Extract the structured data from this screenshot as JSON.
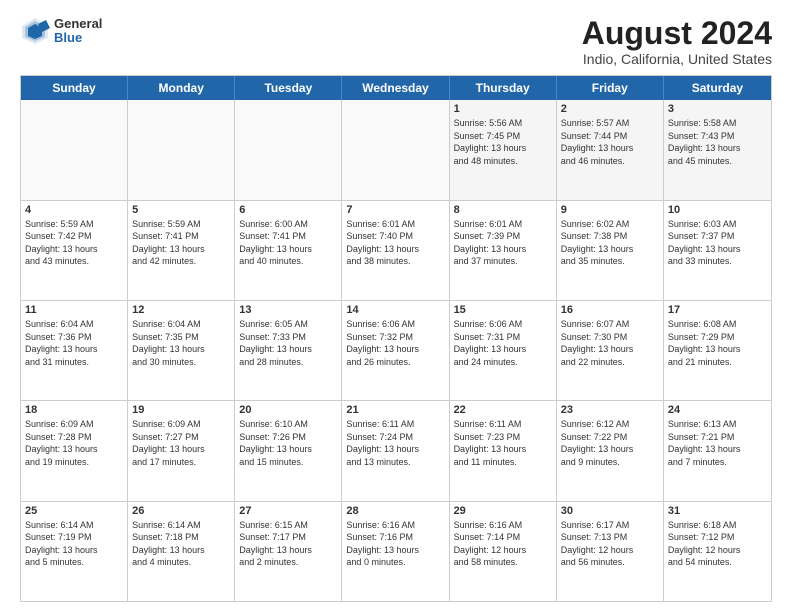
{
  "logo": {
    "general": "General",
    "blue": "Blue"
  },
  "title": "August 2024",
  "subtitle": "Indio, California, United States",
  "days": [
    "Sunday",
    "Monday",
    "Tuesday",
    "Wednesday",
    "Thursday",
    "Friday",
    "Saturday"
  ],
  "weeks": [
    [
      {
        "day": "",
        "text": "",
        "empty": true
      },
      {
        "day": "",
        "text": "",
        "empty": true
      },
      {
        "day": "",
        "text": "",
        "empty": true
      },
      {
        "day": "",
        "text": "",
        "empty": true
      },
      {
        "day": "1",
        "text": "Sunrise: 5:56 AM\nSunset: 7:45 PM\nDaylight: 13 hours\nand 48 minutes."
      },
      {
        "day": "2",
        "text": "Sunrise: 5:57 AM\nSunset: 7:44 PM\nDaylight: 13 hours\nand 46 minutes."
      },
      {
        "day": "3",
        "text": "Sunrise: 5:58 AM\nSunset: 7:43 PM\nDaylight: 13 hours\nand 45 minutes."
      }
    ],
    [
      {
        "day": "4",
        "text": "Sunrise: 5:59 AM\nSunset: 7:42 PM\nDaylight: 13 hours\nand 43 minutes."
      },
      {
        "day": "5",
        "text": "Sunrise: 5:59 AM\nSunset: 7:41 PM\nDaylight: 13 hours\nand 42 minutes."
      },
      {
        "day": "6",
        "text": "Sunrise: 6:00 AM\nSunset: 7:41 PM\nDaylight: 13 hours\nand 40 minutes."
      },
      {
        "day": "7",
        "text": "Sunrise: 6:01 AM\nSunset: 7:40 PM\nDaylight: 13 hours\nand 38 minutes."
      },
      {
        "day": "8",
        "text": "Sunrise: 6:01 AM\nSunset: 7:39 PM\nDaylight: 13 hours\nand 37 minutes."
      },
      {
        "day": "9",
        "text": "Sunrise: 6:02 AM\nSunset: 7:38 PM\nDaylight: 13 hours\nand 35 minutes."
      },
      {
        "day": "10",
        "text": "Sunrise: 6:03 AM\nSunset: 7:37 PM\nDaylight: 13 hours\nand 33 minutes."
      }
    ],
    [
      {
        "day": "11",
        "text": "Sunrise: 6:04 AM\nSunset: 7:36 PM\nDaylight: 13 hours\nand 31 minutes."
      },
      {
        "day": "12",
        "text": "Sunrise: 6:04 AM\nSunset: 7:35 PM\nDaylight: 13 hours\nand 30 minutes."
      },
      {
        "day": "13",
        "text": "Sunrise: 6:05 AM\nSunset: 7:33 PM\nDaylight: 13 hours\nand 28 minutes."
      },
      {
        "day": "14",
        "text": "Sunrise: 6:06 AM\nSunset: 7:32 PM\nDaylight: 13 hours\nand 26 minutes."
      },
      {
        "day": "15",
        "text": "Sunrise: 6:06 AM\nSunset: 7:31 PM\nDaylight: 13 hours\nand 24 minutes."
      },
      {
        "day": "16",
        "text": "Sunrise: 6:07 AM\nSunset: 7:30 PM\nDaylight: 13 hours\nand 22 minutes."
      },
      {
        "day": "17",
        "text": "Sunrise: 6:08 AM\nSunset: 7:29 PM\nDaylight: 13 hours\nand 21 minutes."
      }
    ],
    [
      {
        "day": "18",
        "text": "Sunrise: 6:09 AM\nSunset: 7:28 PM\nDaylight: 13 hours\nand 19 minutes."
      },
      {
        "day": "19",
        "text": "Sunrise: 6:09 AM\nSunset: 7:27 PM\nDaylight: 13 hours\nand 17 minutes."
      },
      {
        "day": "20",
        "text": "Sunrise: 6:10 AM\nSunset: 7:26 PM\nDaylight: 13 hours\nand 15 minutes."
      },
      {
        "day": "21",
        "text": "Sunrise: 6:11 AM\nSunset: 7:24 PM\nDaylight: 13 hours\nand 13 minutes."
      },
      {
        "day": "22",
        "text": "Sunrise: 6:11 AM\nSunset: 7:23 PM\nDaylight: 13 hours\nand 11 minutes."
      },
      {
        "day": "23",
        "text": "Sunrise: 6:12 AM\nSunset: 7:22 PM\nDaylight: 13 hours\nand 9 minutes."
      },
      {
        "day": "24",
        "text": "Sunrise: 6:13 AM\nSunset: 7:21 PM\nDaylight: 13 hours\nand 7 minutes."
      }
    ],
    [
      {
        "day": "25",
        "text": "Sunrise: 6:14 AM\nSunset: 7:19 PM\nDaylight: 13 hours\nand 5 minutes."
      },
      {
        "day": "26",
        "text": "Sunrise: 6:14 AM\nSunset: 7:18 PM\nDaylight: 13 hours\nand 4 minutes."
      },
      {
        "day": "27",
        "text": "Sunrise: 6:15 AM\nSunset: 7:17 PM\nDaylight: 13 hours\nand 2 minutes."
      },
      {
        "day": "28",
        "text": "Sunrise: 6:16 AM\nSunset: 7:16 PM\nDaylight: 13 hours\nand 0 minutes."
      },
      {
        "day": "29",
        "text": "Sunrise: 6:16 AM\nSunset: 7:14 PM\nDaylight: 12 hours\nand 58 minutes."
      },
      {
        "day": "30",
        "text": "Sunrise: 6:17 AM\nSunset: 7:13 PM\nDaylight: 12 hours\nand 56 minutes."
      },
      {
        "day": "31",
        "text": "Sunrise: 6:18 AM\nSunset: 7:12 PM\nDaylight: 12 hours\nand 54 minutes."
      }
    ]
  ]
}
